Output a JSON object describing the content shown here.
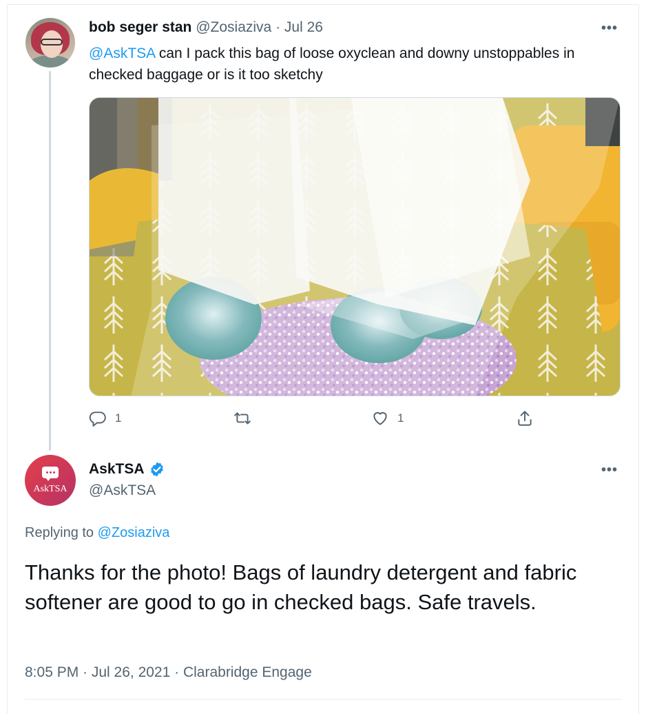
{
  "tweet": {
    "author_name": "bob seger stan",
    "handle": "@Zosiaziva",
    "separator": "·",
    "date": "Jul 26",
    "mention": "@AskTSA",
    "text": " can I pack this bag of loose oxyclean and downy unstoppables in checked baggage or is it too sketchy",
    "more": "•••",
    "reply_count": "1",
    "like_count": "1"
  },
  "reply": {
    "author_name": "AskTSA",
    "handle": "@AskTSA",
    "avatar_text": "AskTSA",
    "replying_label": "Replying to ",
    "replying_handle": "@Zosiaziva",
    "text": "Thanks for the photo! Bags of laundry detergent and fabric softener are good to go in checked bags. Safe travels.",
    "timestamp": "8:05 PM · Jul 26, 2021 · Clarabridge Engage",
    "more": "•••"
  },
  "colors": {
    "link": "#1d9bf0",
    "muted": "#536471",
    "text": "#0f1419",
    "verified": "#1d9bf0"
  },
  "icons": {
    "reply": "speech-bubble-icon",
    "retweet": "retweet-icon",
    "like": "heart-icon",
    "share": "share-icon",
    "verified": "verified-badge-icon",
    "more": "more-dots-icon"
  }
}
